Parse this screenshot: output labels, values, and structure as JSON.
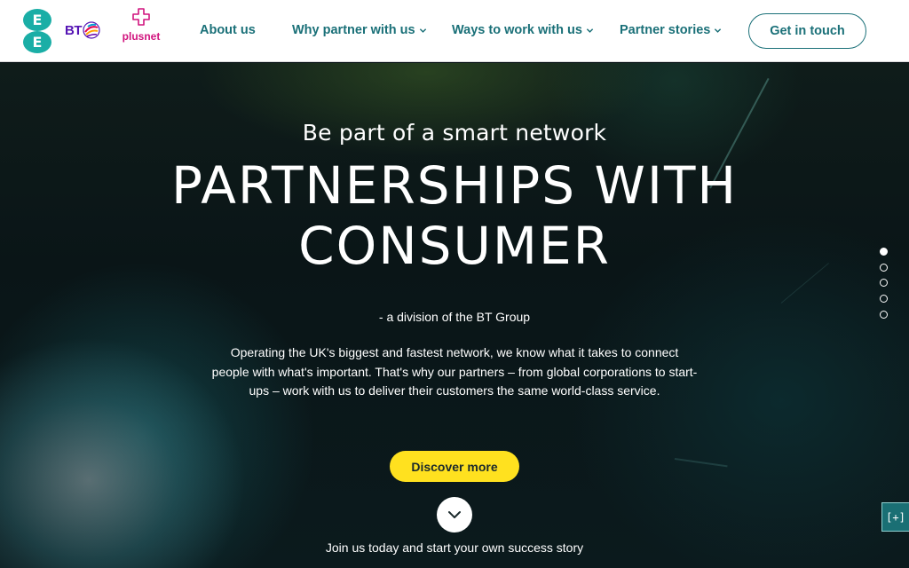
{
  "header": {
    "logos": {
      "ee": "E E",
      "bt": "BT",
      "plusnet": "plusnet"
    },
    "nav": [
      {
        "label": "About us",
        "has_dropdown": false
      },
      {
        "label": "Why partner with us",
        "has_dropdown": true
      },
      {
        "label": "Ways to work with us",
        "has_dropdown": true
      },
      {
        "label": "Partner stories",
        "has_dropdown": true
      }
    ],
    "cta_label": "Get in touch"
  },
  "hero": {
    "subtitle": "Be part of a smart network",
    "title_line1": "PARTNERSHIPS WITH",
    "title_line2": "CONSUMER",
    "division": "- a division of the BT Group",
    "body": "Operating the UK's biggest and fastest network, we know what it takes to connect people with what's important. That's why our partners – from global corporations to start-ups – work with us to deliver their customers the same world-class service.",
    "discover_label": "Discover more",
    "footer_text": "Join us today and start your own success story",
    "slides": {
      "count": 5,
      "active_index": 0
    },
    "expand_label": "[+]"
  },
  "colors": {
    "brand_teal": "#1a7078",
    "ee_teal": "#1aaea6",
    "bt_purple": "#5514b4",
    "plusnet_pink": "#d1147e",
    "cta_yellow": "#ffe11f"
  },
  "icons": {
    "dropdown": "chevron-down-icon",
    "scroll": "chevron-down-icon",
    "expand": "expand-icon"
  }
}
